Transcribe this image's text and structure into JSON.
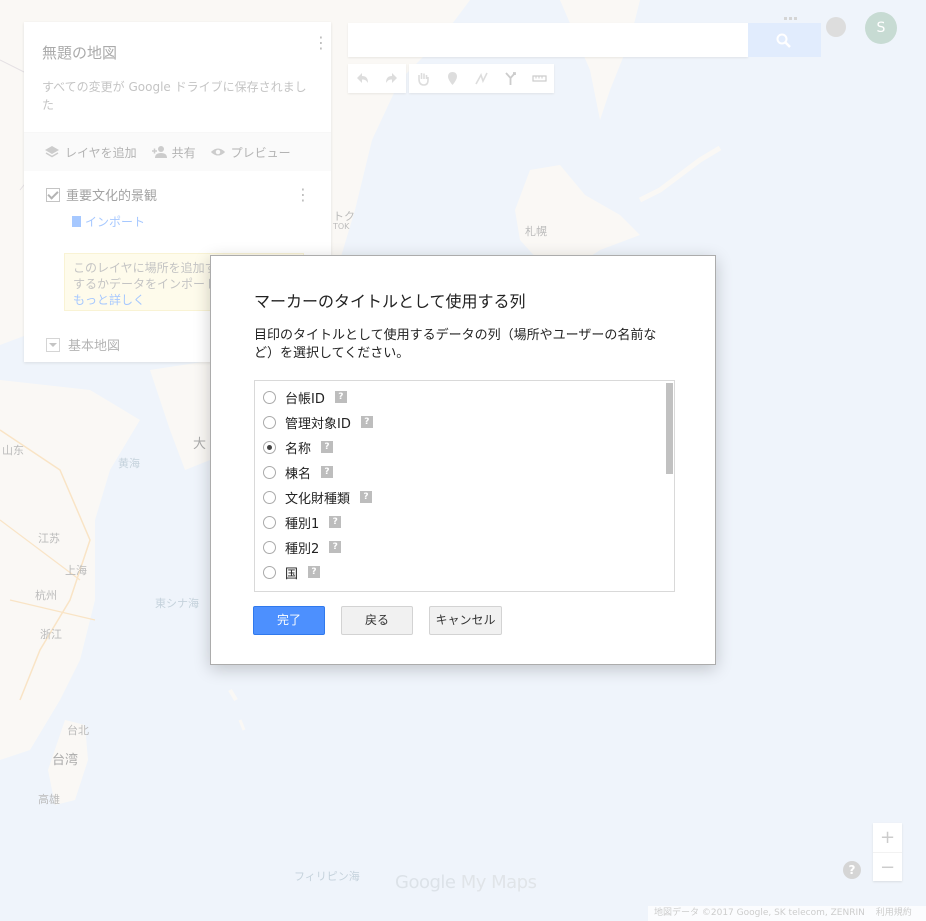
{
  "map_panel": {
    "title": "無題の地図",
    "save_status": "すべての変更が Google ドライブに保存されました",
    "actions": {
      "add_layer": "レイヤを追加",
      "share": "共有",
      "preview": "プレビュー"
    },
    "layer": {
      "name": "重要文化的景観",
      "import_label": "インポート",
      "hint_text": "このレイヤに場所を追加するには、描画するかデータをインポートします。",
      "hint_link": "もっと詳しく"
    },
    "base_map_label": "基本地図"
  },
  "header": {
    "avatar_initial": "S"
  },
  "map_labels": {
    "sapporo": "札幌",
    "tokyo_partial": "トク",
    "tokyo_partial_latin": "TOK",
    "yellow_sea": "黄海",
    "daegu_partial": "大",
    "shandong": "山东",
    "jiangsu": "江苏",
    "shanghai": "上海",
    "hangzhou": "杭州",
    "zhejiang": "浙江",
    "east_china_sea": "東シナ海",
    "taipei": "台北",
    "taiwan": "台湾",
    "kaohsiung": "高雄",
    "philippine_sea": "フィリピン海"
  },
  "logo": {
    "google": "Google",
    "my_maps": "My Maps"
  },
  "footer": {
    "attribution": "地図データ ©2017 Google, SK telecom, ZENRIN",
    "terms": "利用規約"
  },
  "zoom": {
    "in": "+",
    "out": "−"
  },
  "help_label": "?",
  "dialog": {
    "title": "マーカーのタイトルとして使用する列",
    "description": "目印のタイトルとして使用するデータの列（場所やユーザーの名前など）を選択してください。",
    "options": [
      {
        "label": "台帳ID",
        "selected": false
      },
      {
        "label": "管理対象ID",
        "selected": false
      },
      {
        "label": "名称",
        "selected": true
      },
      {
        "label": "棟名",
        "selected": false
      },
      {
        "label": "文化財種類",
        "selected": false
      },
      {
        "label": "種別1",
        "selected": false
      },
      {
        "label": "種別2",
        "selected": false
      },
      {
        "label": "国",
        "selected": false
      }
    ],
    "help_mark": "?",
    "buttons": {
      "done": "完了",
      "back": "戻る",
      "cancel": "キャンセル"
    }
  }
}
